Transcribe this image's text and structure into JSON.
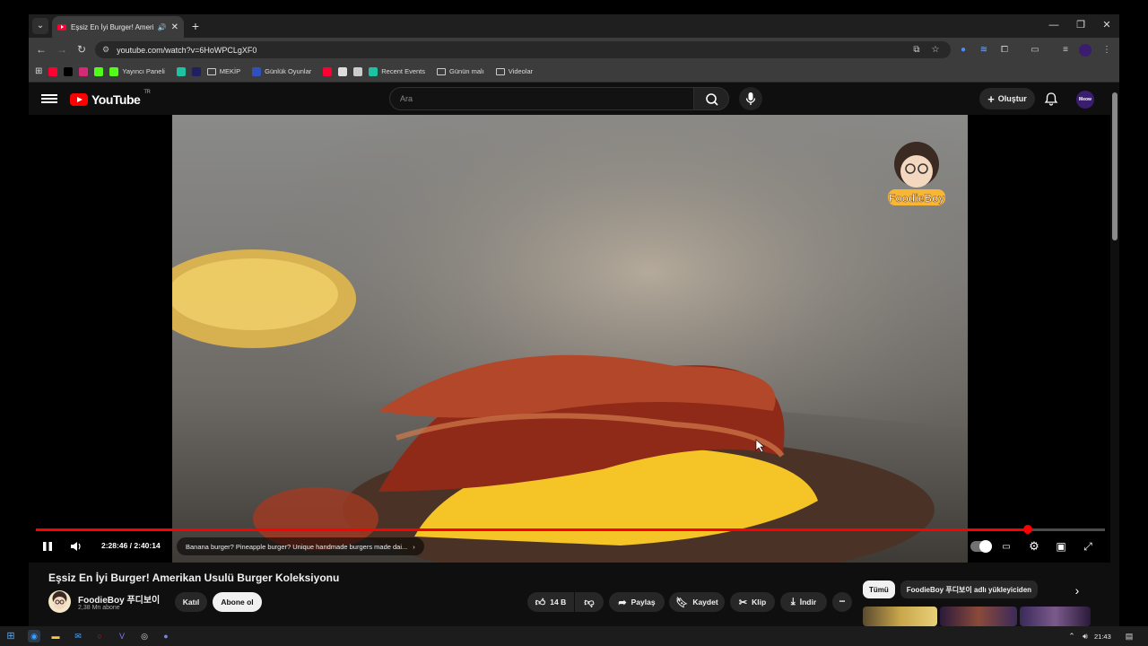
{
  "browser": {
    "tab_title": "Eşsiz En İyi Burger! Amerika",
    "url": "youtube.com/watch?v=6HoWPCLgXF0",
    "new_tab_glyph": "+",
    "bookmarks": [
      {
        "label": "",
        "icon": "youtube-icon",
        "color": "#ff0033"
      },
      {
        "label": "",
        "icon": "x-icon",
        "color": "#000000"
      },
      {
        "label": "",
        "icon": "instagram-icon",
        "color": "#d62976"
      },
      {
        "label": "",
        "icon": "kick-icon",
        "color": "#53fc18"
      },
      {
        "label": "Yayıncı Paneli",
        "icon": "kick-icon",
        "color": "#53fc18"
      },
      {
        "label": "",
        "icon": "chat-icon",
        "color": "#1dc2a1"
      },
      {
        "label": "",
        "icon": "prompt-icon",
        "color": "#202060"
      },
      {
        "label": "MEKİP",
        "icon": "folder-icon",
        "color": ""
      },
      {
        "label": "Günlük Oyunlar",
        "icon": "globe-icon",
        "color": "#3050c0"
      },
      {
        "label": "",
        "icon": "youtube-icon",
        "color": "#ff0033"
      },
      {
        "label": "",
        "icon": "image-icon",
        "color": "#dddddd"
      },
      {
        "label": "",
        "icon": "chatgpt-icon",
        "color": "#cccccc"
      },
      {
        "label": "Recent Events",
        "icon": "events-icon",
        "color": "#1dc2a1"
      },
      {
        "label": "Günün malı",
        "icon": "folder-icon",
        "color": ""
      },
      {
        "label": "Videolar",
        "icon": "folder-icon",
        "color": ""
      }
    ]
  },
  "youtube": {
    "logo_text": "YouTube",
    "country": "TR",
    "search_placeholder": "Ara",
    "create_label": "Oluştur",
    "avatar_text": "Meow",
    "player": {
      "watermark": "FoodieBoy",
      "time_current": "2:28:46",
      "time_total": "2:40:14",
      "time_display": "2:28:46 / 2:40:14",
      "progress": 0.928,
      "chapter": "Banana burger? Pineapple burger? Unique handmade burgers made dai..."
    },
    "video_title": "Eşsiz En İyi Burger! Amerikan Usulü Burger Koleksiyonu",
    "channel_name": "FoodieBoy 푸디보이",
    "subscribers": "2,38 Mn abone",
    "join_label": "Katıl",
    "subscribe_label": "Abone ol",
    "like_count": "14 B",
    "share_label": "Paylaş",
    "save_label": "Kaydet",
    "clip_label": "Klip",
    "download_label": "İndir",
    "more_glyph": "•••",
    "chips": [
      "Tümü",
      "FoodieBoy 푸디보이 adlı yükleyiciden"
    ]
  },
  "taskbar": {
    "time": "21:43"
  }
}
